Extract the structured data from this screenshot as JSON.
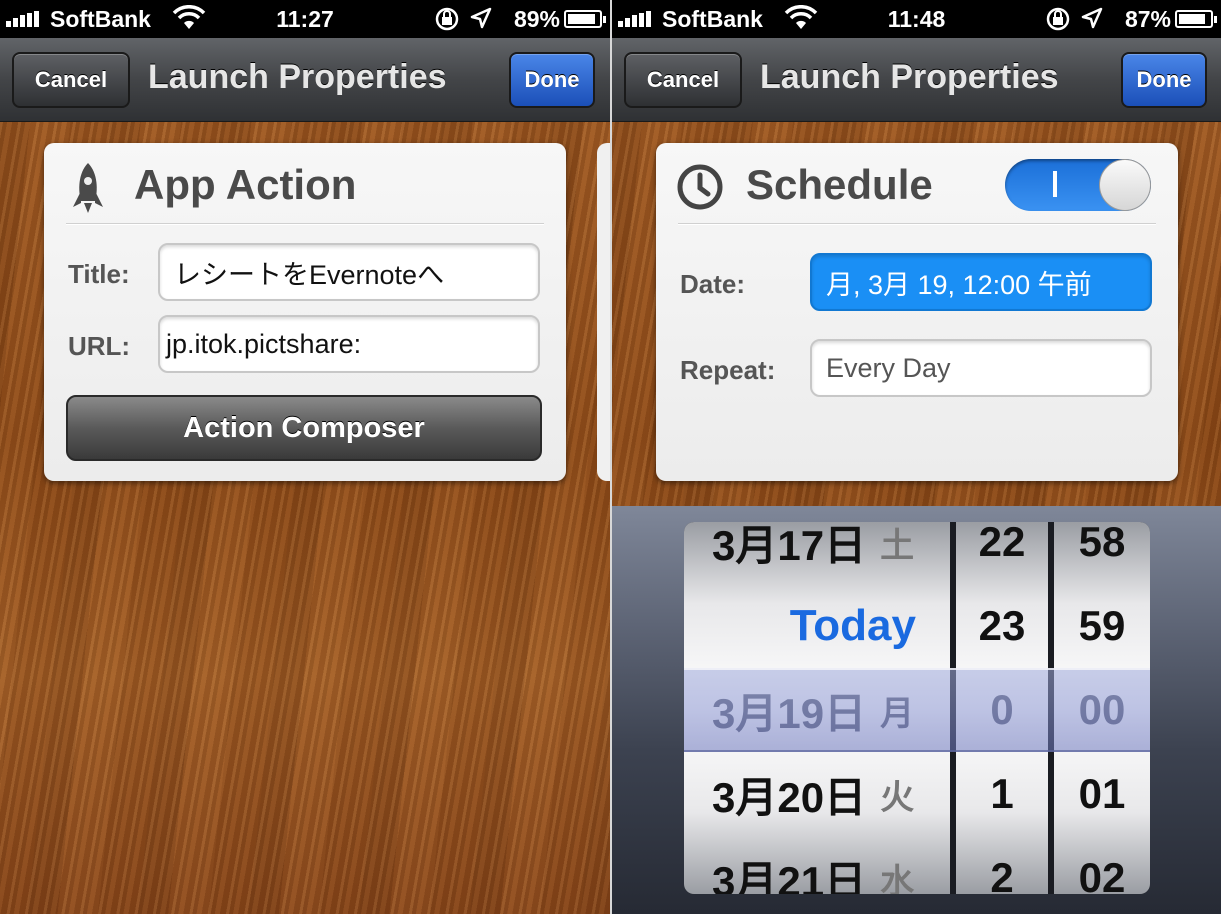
{
  "left": {
    "status": {
      "carrier": "SoftBank",
      "time": "11:27",
      "battery_pct": "89%",
      "battery_level": 0.89
    },
    "nav": {
      "cancel": "Cancel",
      "title": "Launch Properties",
      "done": "Done"
    },
    "card": {
      "icon": "rocket-icon",
      "title": "App Action",
      "title_label": "Title:",
      "title_value": "レシートをEvernoteへ",
      "url_label": "URL:",
      "url_value": "jp.itok.pictshare:",
      "composer": "Action Composer"
    }
  },
  "right": {
    "status": {
      "carrier": "SoftBank",
      "time": "11:48",
      "battery_pct": "87%",
      "battery_level": 0.87
    },
    "nav": {
      "cancel": "Cancel",
      "title": "Launch Properties",
      "done": "Done"
    },
    "card": {
      "icon": "clock-icon",
      "title": "Schedule",
      "toggle_on": true,
      "date_label": "Date:",
      "date_value": "月, 3月 19, 12:00 午前",
      "repeat_label": "Repeat:",
      "repeat_value": "Every Day"
    },
    "picker": {
      "dates": [
        {
          "date": "3月17日",
          "wd": "土"
        },
        {
          "date": "Today",
          "wd": ""
        },
        {
          "date": "3月19日",
          "wd": "月"
        },
        {
          "date": "3月20日",
          "wd": "火"
        },
        {
          "date": "3月21日",
          "wd": "水"
        }
      ],
      "hours": [
        "22",
        "23",
        "0",
        "1",
        "2"
      ],
      "minutes": [
        "58",
        "59",
        "00",
        "01",
        "02"
      ],
      "selected_index": 2
    }
  }
}
